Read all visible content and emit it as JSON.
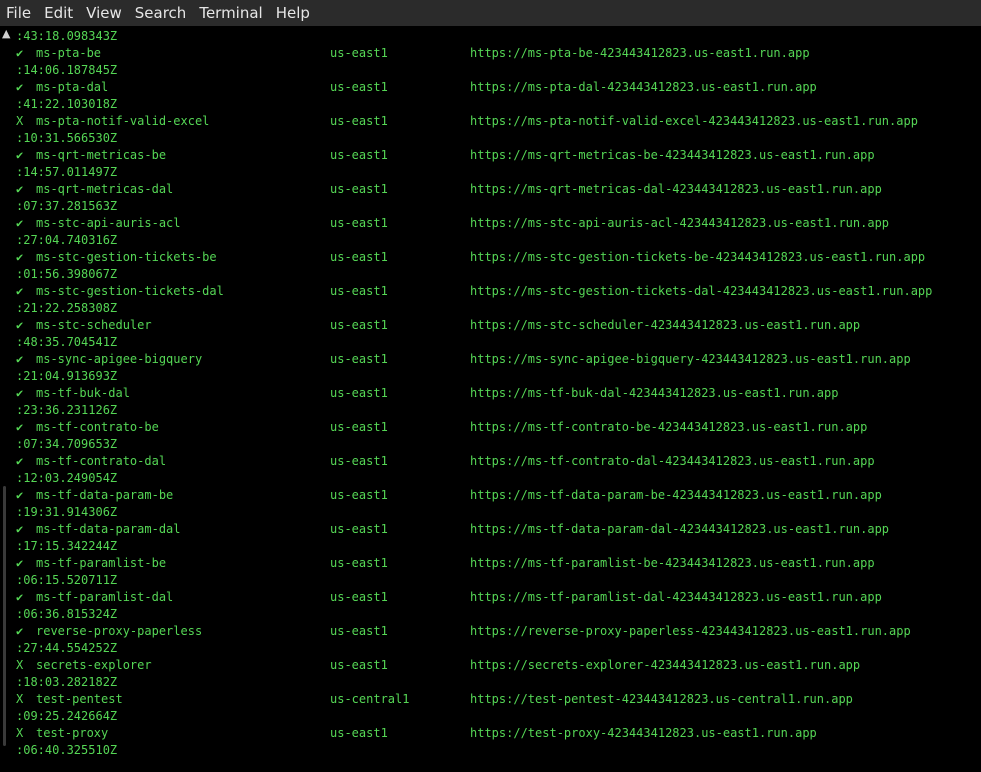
{
  "menu": [
    "File",
    "Edit",
    "View",
    "Search",
    "Terminal",
    "Help"
  ],
  "first_timestamp": ":43:18.098343Z",
  "services": [
    {
      "status": "✔",
      "name": "ms-pta-be",
      "region": "us-east1",
      "url": "https://ms-pta-be-423443412823.us-east1.run.app",
      "ts": ":14:06.187845Z"
    },
    {
      "status": "✔",
      "name": "ms-pta-dal",
      "region": "us-east1",
      "url": "https://ms-pta-dal-423443412823.us-east1.run.app",
      "ts": ":41:22.103018Z"
    },
    {
      "status": "X",
      "name": "ms-pta-notif-valid-excel",
      "region": "us-east1",
      "url": "https://ms-pta-notif-valid-excel-423443412823.us-east1.run.app",
      "ts": ":10:31.566530Z"
    },
    {
      "status": "✔",
      "name": "ms-qrt-metricas-be",
      "region": "us-east1",
      "url": "https://ms-qrt-metricas-be-423443412823.us-east1.run.app",
      "ts": ":14:57.011497Z"
    },
    {
      "status": "✔",
      "name": "ms-qrt-metricas-dal",
      "region": "us-east1",
      "url": "https://ms-qrt-metricas-dal-423443412823.us-east1.run.app",
      "ts": ":07:37.281563Z"
    },
    {
      "status": "✔",
      "name": "ms-stc-api-auris-acl",
      "region": "us-east1",
      "url": "https://ms-stc-api-auris-acl-423443412823.us-east1.run.app",
      "ts": ":27:04.740316Z"
    },
    {
      "status": "✔",
      "name": "ms-stc-gestion-tickets-be",
      "region": "us-east1",
      "url": "https://ms-stc-gestion-tickets-be-423443412823.us-east1.run.app",
      "ts": ":01:56.398067Z"
    },
    {
      "status": "✔",
      "name": "ms-stc-gestion-tickets-dal",
      "region": "us-east1",
      "url": "https://ms-stc-gestion-tickets-dal-423443412823.us-east1.run.app",
      "ts": ":21:22.258308Z"
    },
    {
      "status": "✔",
      "name": "ms-stc-scheduler",
      "region": "us-east1",
      "url": "https://ms-stc-scheduler-423443412823.us-east1.run.app",
      "ts": ":48:35.704541Z"
    },
    {
      "status": "✔",
      "name": "ms-sync-apigee-bigquery",
      "region": "us-east1",
      "url": "https://ms-sync-apigee-bigquery-423443412823.us-east1.run.app",
      "ts": ":21:04.913693Z"
    },
    {
      "status": "✔",
      "name": "ms-tf-buk-dal",
      "region": "us-east1",
      "url": "https://ms-tf-buk-dal-423443412823.us-east1.run.app",
      "ts": ":23:36.231126Z"
    },
    {
      "status": "✔",
      "name": "ms-tf-contrato-be",
      "region": "us-east1",
      "url": "https://ms-tf-contrato-be-423443412823.us-east1.run.app",
      "ts": ":07:34.709653Z"
    },
    {
      "status": "✔",
      "name": "ms-tf-contrato-dal",
      "region": "us-east1",
      "url": "https://ms-tf-contrato-dal-423443412823.us-east1.run.app",
      "ts": ":12:03.249054Z"
    },
    {
      "status": "✔",
      "name": "ms-tf-data-param-be",
      "region": "us-east1",
      "url": "https://ms-tf-data-param-be-423443412823.us-east1.run.app",
      "ts": ":19:31.914306Z"
    },
    {
      "status": "✔",
      "name": "ms-tf-data-param-dal",
      "region": "us-east1",
      "url": "https://ms-tf-data-param-dal-423443412823.us-east1.run.app",
      "ts": ":17:15.342244Z"
    },
    {
      "status": "✔",
      "name": "ms-tf-paramlist-be",
      "region": "us-east1",
      "url": "https://ms-tf-paramlist-be-423443412823.us-east1.run.app",
      "ts": ":06:15.520711Z"
    },
    {
      "status": "✔",
      "name": "ms-tf-paramlist-dal",
      "region": "us-east1",
      "url": "https://ms-tf-paramlist-dal-423443412823.us-east1.run.app",
      "ts": ":06:36.815324Z"
    },
    {
      "status": "✔",
      "name": "reverse-proxy-paperless",
      "region": "us-east1",
      "url": "https://reverse-proxy-paperless-423443412823.us-east1.run.app",
      "ts": ":27:44.554252Z"
    },
    {
      "status": "X",
      "name": "secrets-explorer",
      "region": "us-east1",
      "url": "https://secrets-explorer-423443412823.us-east1.run.app",
      "ts": ":18:03.282182Z"
    },
    {
      "status": "X",
      "name": "test-pentest",
      "region": "us-central1",
      "url": "https://test-pentest-423443412823.us-central1.run.app",
      "ts": ":09:25.242664Z"
    },
    {
      "status": "X",
      "name": "test-proxy",
      "region": "us-east1",
      "url": "https://test-proxy-423443412823.us-east1.run.app",
      "ts": ":06:40.325510Z"
    }
  ],
  "colors": {
    "terminal_bg": "#000000",
    "terminal_text": "#55d655",
    "menubar_bg": "#2b2b2b",
    "menubar_text": "#e6e6e6"
  }
}
